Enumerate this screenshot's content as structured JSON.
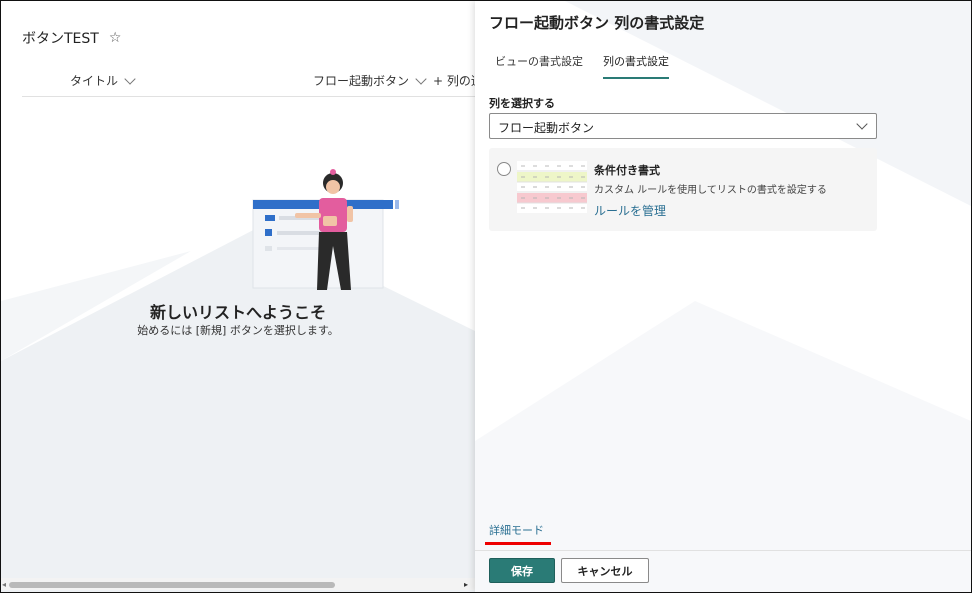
{
  "list": {
    "title": "ボタンTEST",
    "star_icon": "☆",
    "columns": [
      {
        "label": "タイトル"
      },
      {
        "label": "フロー起動ボタン"
      },
      {
        "label": "+ 列の追"
      }
    ],
    "welcome_title": "新しいリストへようこそ",
    "welcome_sub": "始めるには [新規] ボタンを選択します。"
  },
  "panel": {
    "title": "フロー起動ボタン 列の書式設定",
    "tabs": [
      {
        "label": "ビューの書式設定",
        "active": false
      },
      {
        "label": "列の書式設定",
        "active": true
      }
    ],
    "select_label": "列を選択する",
    "select_value": "フロー起動ボタン",
    "option": {
      "title": "条件付き書式",
      "description": "カスタム ルールを使用してリストの書式を設定する",
      "link": "ルールを管理"
    },
    "advanced_link": "詳細モード",
    "save_label": "保存",
    "cancel_label": "キャンセル"
  },
  "colors": {
    "accent": "#2a7b76",
    "link": "#2a6f92",
    "highlight": "#ee0000"
  }
}
